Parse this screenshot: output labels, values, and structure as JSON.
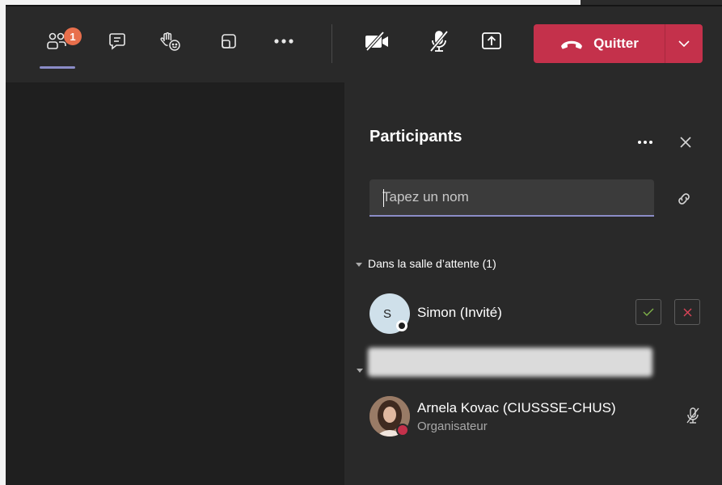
{
  "toolbar": {
    "participants_badge": "1",
    "quit_label": "Quitter",
    "icons": [
      "participants-icon",
      "chat-icon",
      "raise-hand-icon",
      "rooms-icon",
      "more-icon",
      "camera-off-icon",
      "mic-off-icon",
      "share-icon",
      "hang-up-icon",
      "chevron-down-icon"
    ],
    "colors": {
      "accent": "#8b8cc7",
      "badge": "#e86f4c",
      "quit": "#c4314b"
    }
  },
  "panel": {
    "title": "Participants",
    "search_placeholder": "Tapez un nom",
    "waiting_section": "Dans la salle d’attente (1)",
    "waiting": [
      {
        "initial": "S",
        "name": "Simon (Invité)"
      }
    ],
    "in_meeting": [
      {
        "name": "Arnela Kovac (CIUSSSE-CHUS)",
        "role": "Organisateur"
      }
    ]
  }
}
